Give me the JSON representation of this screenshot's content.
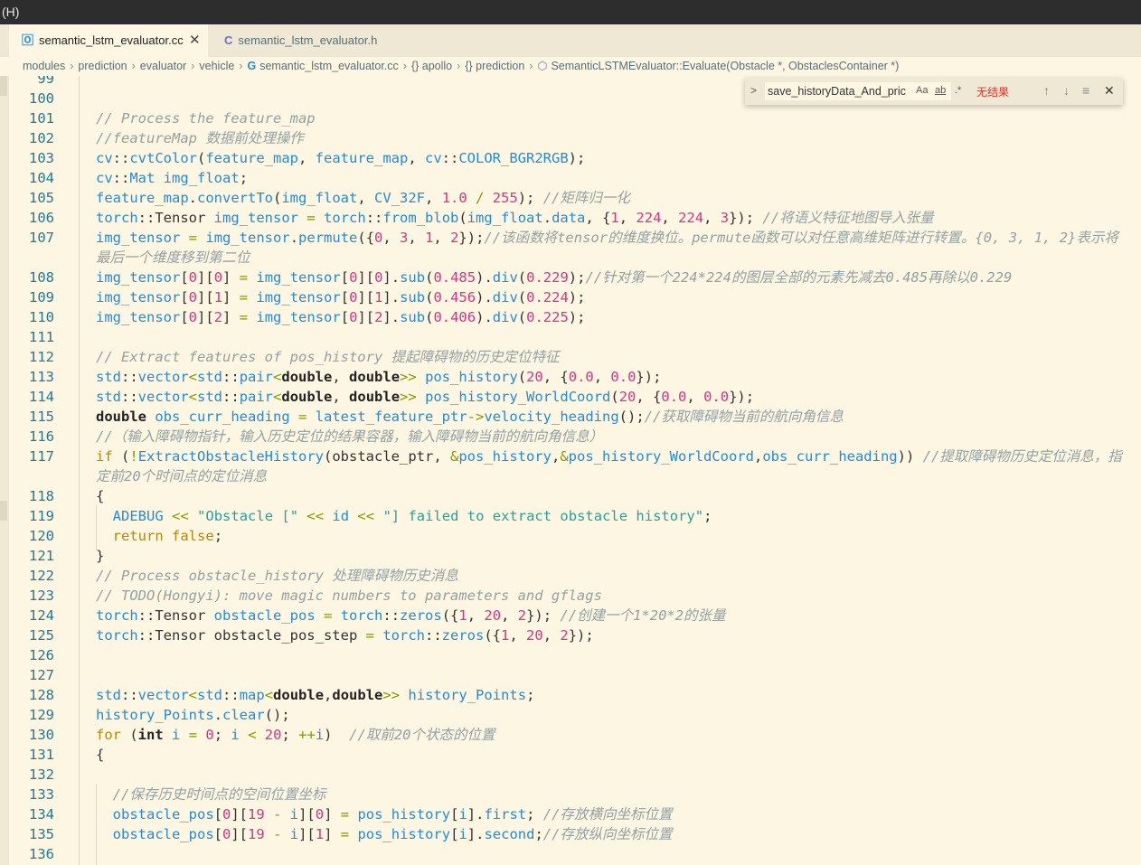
{
  "menu": {
    "label": "(H)"
  },
  "tabs": [
    {
      "label": "semantic_lstm_evaluator.cc",
      "icon": "cpp-file-icon",
      "active": true
    },
    {
      "label": "semantic_lstm_evaluator.h",
      "icon": "c-header-file-icon",
      "active": false
    }
  ],
  "breadcrumb": {
    "items": [
      "modules",
      "prediction",
      "evaluator",
      "vehicle",
      "semantic_lstm_evaluator.cc",
      "{} apollo",
      "{} prediction",
      "SemanticLSTMEvaluator::Evaluate(Obstacle *, ObstaclesContainer *)"
    ]
  },
  "find": {
    "value": "save_historyData_And_pric",
    "match_case": "Aa",
    "whole_word": "ab",
    "regex": ".*",
    "result": "无结果"
  },
  "code_lines": [
    {
      "n": "99",
      "text": ""
    },
    {
      "n": "100",
      "text": ""
    },
    {
      "n": "101",
      "text": "// Process the feature_map"
    },
    {
      "n": "102",
      "text": "//featureMap 数据前处理操作"
    },
    {
      "n": "103",
      "text": "cv::cvtColor(feature_map, feature_map, cv::COLOR_BGR2RGB);"
    },
    {
      "n": "104",
      "text": "cv::Mat img_float;"
    },
    {
      "n": "105",
      "text": "feature_map.convertTo(img_float, CV_32F, 1.0 / 255); //矩阵归一化"
    },
    {
      "n": "106",
      "text": "torch::Tensor img_tensor = torch::from_blob(img_float.data, {1, 224, 224, 3}); //将语义特征地图导入张量"
    },
    {
      "n": "107",
      "text": "img_tensor = img_tensor.permute({0, 3, 1, 2});//该函数将tensor的维度换位。permute函数可以对任意高维矩阵进行转置。{0, 3, 1, 2}表示将最后一个维度移到第二位"
    },
    {
      "n": "108",
      "text": "img_tensor[0][0] = img_tensor[0][0].sub(0.485).div(0.229);//针对第一个224*224的图层全部的元素先减去0.485再除以0.229"
    },
    {
      "n": "109",
      "text": "img_tensor[0][1] = img_tensor[0][1].sub(0.456).div(0.224);"
    },
    {
      "n": "110",
      "text": "img_tensor[0][2] = img_tensor[0][2].sub(0.406).div(0.225);"
    },
    {
      "n": "111",
      "text": ""
    },
    {
      "n": "112",
      "text": "// Extract features of pos_history 提起障碍物的历史定位特征"
    },
    {
      "n": "113",
      "text": "std::vector<std::pair<double, double>> pos_history(20, {0.0, 0.0});"
    },
    {
      "n": "114",
      "text": "std::vector<std::pair<double, double>> pos_history_WorldCoord(20, {0.0, 0.0});"
    },
    {
      "n": "115",
      "text": "double obs_curr_heading = latest_feature_ptr->velocity_heading();//获取障碍物当前的航向角信息"
    },
    {
      "n": "116",
      "text": "//（输入障碍物指针，输入历史定位的结果容器，输入障碍物当前的航向角信息）"
    },
    {
      "n": "117",
      "text": "if (!ExtractObstacleHistory(obstacle_ptr, &pos_history,&pos_history_WorldCoord,obs_curr_heading)) //提取障碍物历史定位消息，指定前20个时间点的定位消息"
    },
    {
      "n": "118",
      "text": "{"
    },
    {
      "n": "119",
      "text": "  ADEBUG << \"Obstacle [\" << id << \"] failed to extract obstacle history\";"
    },
    {
      "n": "120",
      "text": "  return false;"
    },
    {
      "n": "121",
      "text": "}"
    },
    {
      "n": "122",
      "text": "// Process obstacle_history 处理障碍物历史消息"
    },
    {
      "n": "123",
      "text": "// TODO(Hongyi): move magic numbers to parameters and gflags"
    },
    {
      "n": "124",
      "text": "torch::Tensor obstacle_pos = torch::zeros({1, 20, 2}); //创建一个1*20*2的张量"
    },
    {
      "n": "125",
      "text": "torch::Tensor obstacle_pos_step = torch::zeros({1, 20, 2});"
    },
    {
      "n": "126",
      "text": ""
    },
    {
      "n": "127",
      "text": ""
    },
    {
      "n": "128",
      "text": "std::vector<std::map<double,double>> history_Points;"
    },
    {
      "n": "129",
      "text": "history_Points.clear();"
    },
    {
      "n": "130",
      "text": "for (int i = 0; i < 20; ++i)  //取前20个状态的位置"
    },
    {
      "n": "131",
      "text": "{"
    },
    {
      "n": "132",
      "text": ""
    },
    {
      "n": "133",
      "text": "  //保存历史时间点的空间位置坐标"
    },
    {
      "n": "134",
      "text": "  obstacle_pos[0][19 - i][0] = pos_history[i].first; //存放横向坐标位置"
    },
    {
      "n": "135",
      "text": "  obstacle_pos[0][19 - i][1] = pos_history[i].second;//存放纵向坐标位置"
    },
    {
      "n": "136",
      "text": ""
    }
  ]
}
